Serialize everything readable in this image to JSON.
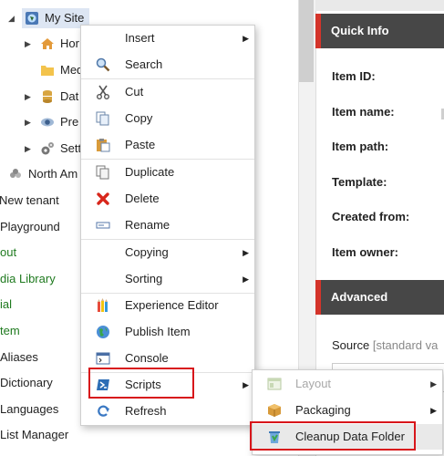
{
  "tree": {
    "root": "My Site",
    "children": [
      "Hor",
      "Med",
      "Dat",
      "Pre",
      "Sett"
    ],
    "tenant_label": "North Am",
    "siblings": [
      "New tenant",
      "Playground",
      "out",
      "dia Library",
      "ial",
      "tem",
      "Aliases",
      "Dictionary",
      "Languages",
      "List Manager"
    ]
  },
  "right_panel": {
    "quick_info_title": "Quick Info",
    "rows": [
      "Item ID:",
      "Item name:",
      "Item path:",
      "Template:",
      "Created from:",
      "Item owner:"
    ],
    "advanced_title": "Advanced",
    "source_label": "Source",
    "source_hint": "[standard va"
  },
  "context_menu": {
    "items": [
      {
        "label": "Insert",
        "icon": "insert-blank",
        "submenu": true
      },
      {
        "label": "Search",
        "icon": "magnifier-icon"
      },
      {
        "label": "Cut",
        "icon": "scissors-icon"
      },
      {
        "label": "Copy",
        "icon": "copy-icon"
      },
      {
        "label": "Paste",
        "icon": "paste-icon"
      },
      {
        "label": "Duplicate",
        "icon": "duplicate-icon"
      },
      {
        "label": "Delete",
        "icon": "red-x-icon"
      },
      {
        "label": "Rename",
        "icon": "rename-icon"
      },
      {
        "label": "Copying",
        "submenu": true
      },
      {
        "label": "Sorting",
        "submenu": true
      },
      {
        "label": "Experience Editor",
        "icon": "pencils-icon"
      },
      {
        "label": "Publish Item",
        "icon": "globe-icon"
      },
      {
        "label": "Console",
        "icon": "console-icon"
      },
      {
        "label": "Scripts",
        "icon": "powershell-icon",
        "submenu": true
      },
      {
        "label": "Refresh",
        "icon": "refresh-icon"
      }
    ]
  },
  "scripts_submenu": {
    "items": [
      {
        "label": "Layout",
        "disabled": true,
        "submenu": true
      },
      {
        "label": "Packaging",
        "submenu": true
      },
      {
        "label": "Cleanup Data Folder"
      }
    ]
  },
  "colors": {
    "highlight_red": "#d8161b",
    "section_header": "#474747",
    "section_accent": "#d4342a",
    "tree_green": "#1f7a1f"
  }
}
